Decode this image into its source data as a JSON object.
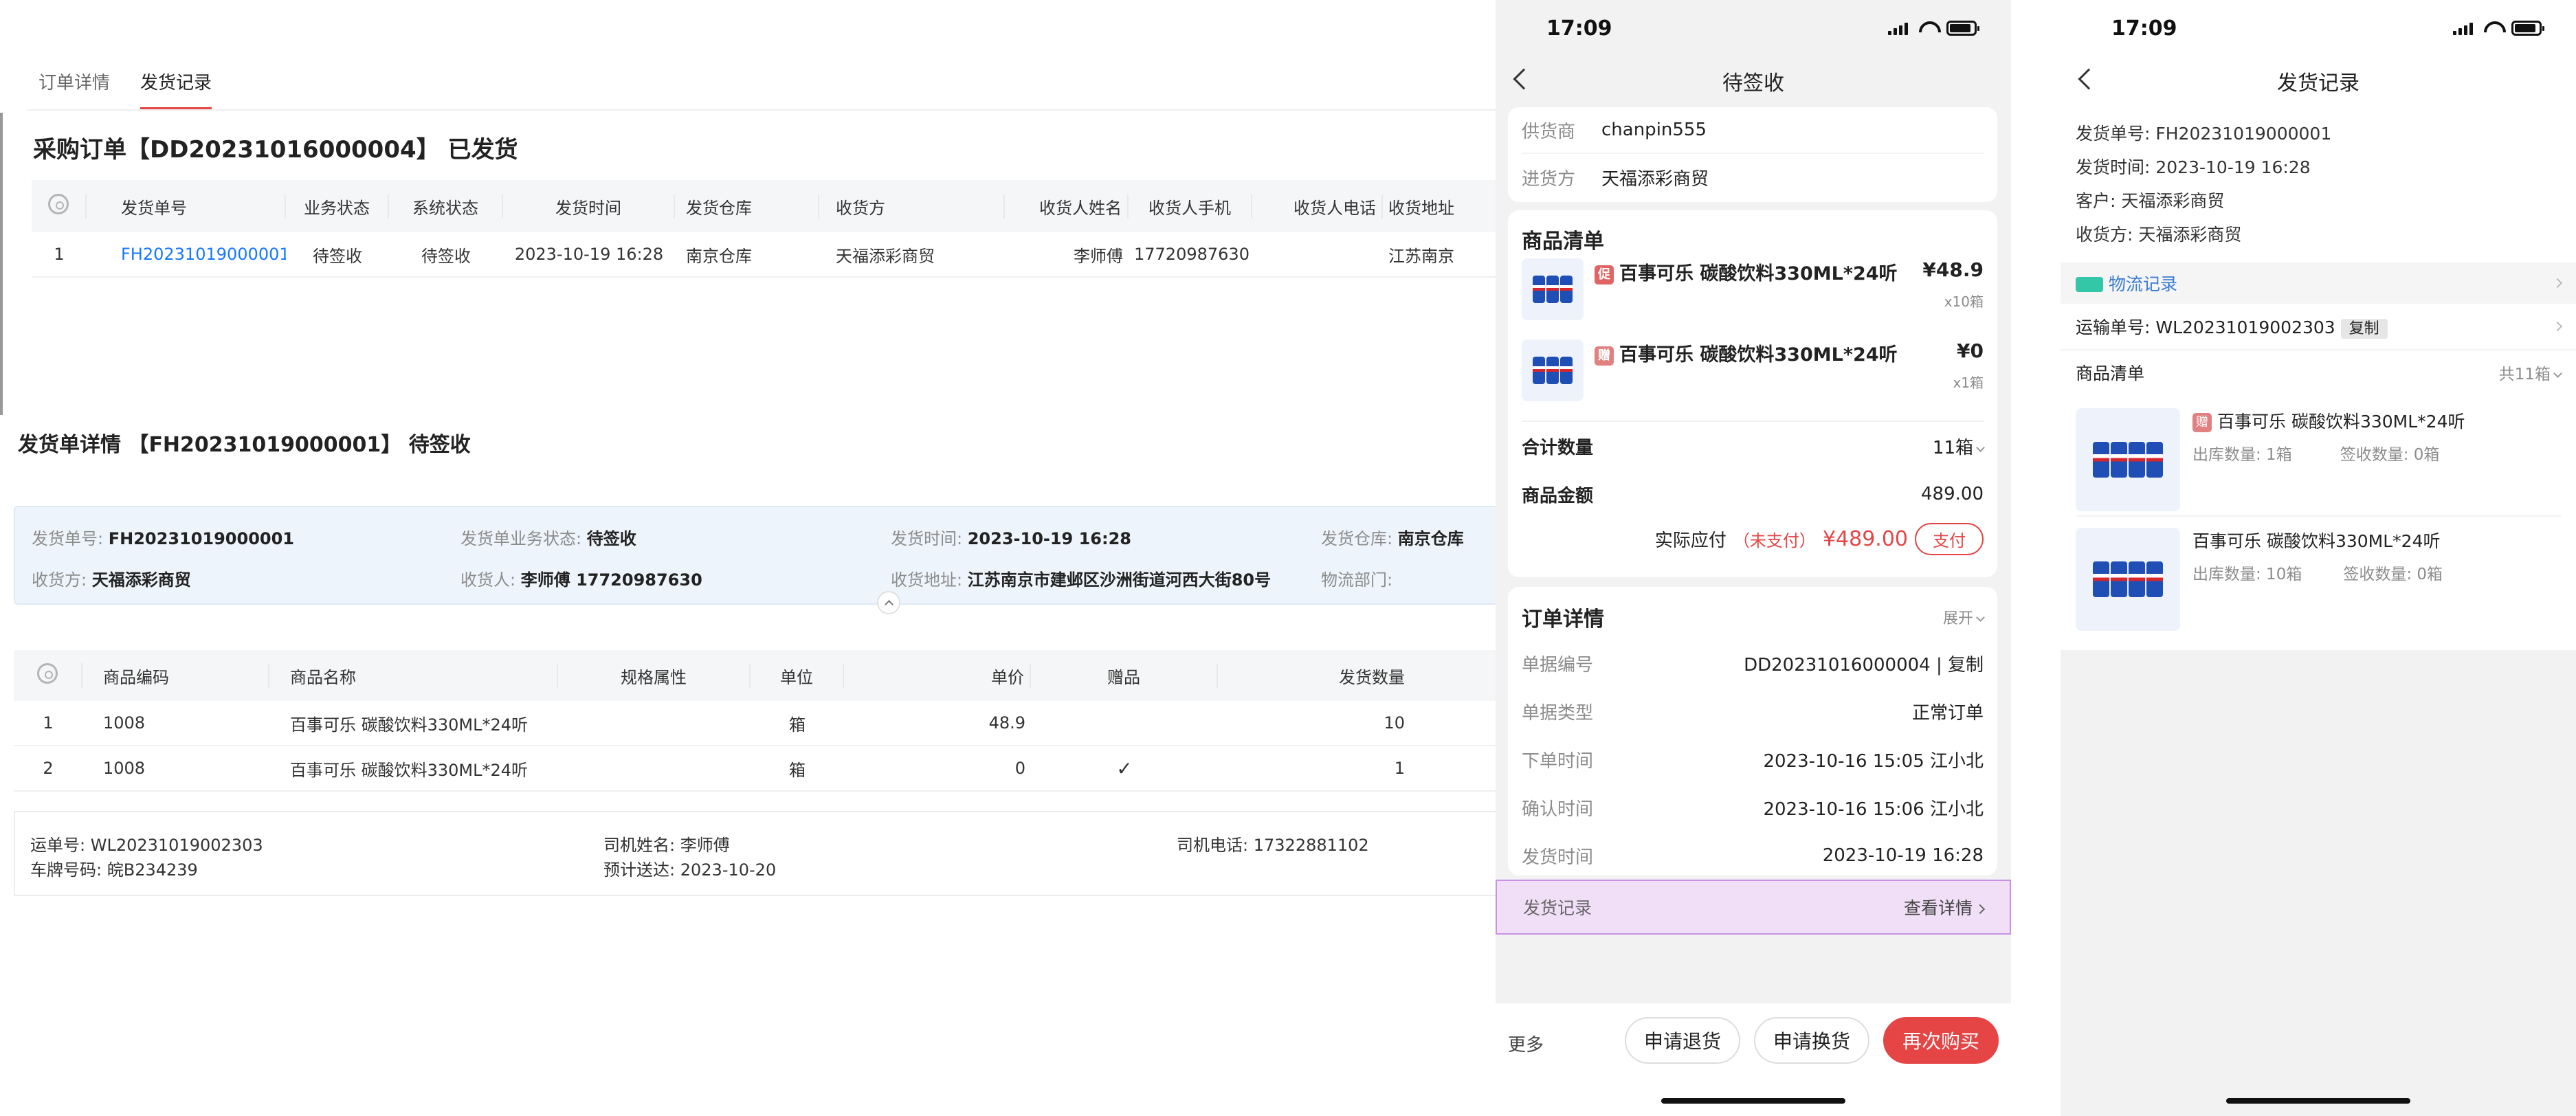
{
  "desktop": {
    "tabs": [
      {
        "label": "订单详情"
      },
      {
        "label": "发货记录"
      }
    ],
    "order_title": "采购订单【DD20231016000004】 已发货",
    "table1": {
      "headers": [
        "发货单号",
        "业务状态",
        "系统状态",
        "发货时间",
        "发货仓库",
        "收货方",
        "收货人姓名",
        "收货人手机",
        "收货人电话",
        "收货地址"
      ],
      "rows": [
        [
          "1",
          "FH20231019000001",
          "待签收",
          "待签收",
          "2023-10-19 16:28",
          "南京仓库",
          "天福添彩商贸",
          "李师傅",
          "17720987630",
          "",
          "江苏南京"
        ]
      ]
    },
    "detail_title": "发货单详情 【FH20231019000001】 待签收",
    "info": {
      "ship_no_label": "发货单号:",
      "ship_no": "FH20231019000001",
      "biz_status_label": "发货单业务状态:",
      "biz_status": "待签收",
      "ship_time_label": "发货时间:",
      "ship_time": "2023-10-19 16:28",
      "warehouse_label": "发货仓库:",
      "warehouse": "南京仓库",
      "receiver_label": "收货方:",
      "receiver": "天福添彩商贸",
      "contact_label": "收货人:",
      "contact": "李师傅 17720987630",
      "address_label": "收货地址:",
      "address": "江苏南京市建邺区沙洲街道河西大街80号",
      "logistics_label": "物流部门:",
      "logistics": ""
    },
    "table2": {
      "headers": [
        "商品编码",
        "商品名称",
        "规格属性",
        "单位",
        "单价",
        "赠品",
        "发货数量"
      ],
      "rows": [
        [
          "1",
          "1008",
          "百事可乐 碳酸饮料330ML*24听",
          "",
          "箱",
          "48.9",
          "",
          "10"
        ],
        [
          "2",
          "1008",
          "百事可乐 碳酸饮料330ML*24听",
          "",
          "箱",
          "0",
          "✓",
          "1"
        ]
      ]
    },
    "shipping": {
      "waybill_label": "运单号:",
      "waybill": "WL20231019002303",
      "driver_label": "司机姓名:",
      "driver": "李师傅",
      "driver_phone_label": "司机电话:",
      "driver_phone": "17322881102",
      "plate_label": "车牌号码:",
      "plate": "皖B234239",
      "eta_label": "预计送达:",
      "eta": "2023-10-20"
    }
  },
  "phone1": {
    "time": "17:09",
    "title": "待签收",
    "supplier_label": "供货商",
    "supplier": "chanpin555",
    "buyer_label": "进货方",
    "buyer": "天福添彩商贸",
    "goods_title": "商品清单",
    "items": [
      {
        "badge": "促",
        "name": "百事可乐 碳酸饮料330ML*24听",
        "price": "¥48.9",
        "qty": "x10箱"
      },
      {
        "badge": "赠",
        "name": "百事可乐 碳酸饮料330ML*24听",
        "price": "¥0",
        "qty": "x1箱"
      }
    ],
    "total_qty_label": "合计数量",
    "total_qty": "11箱",
    "amount_label": "商品金额",
    "amount": "489.00",
    "payable_label": "实际应付",
    "unpaid": "（未支付）",
    "payable": "¥489.00",
    "pay_button": "支付",
    "order_detail_title": "订单详情",
    "expand_label": "展开",
    "details": [
      {
        "label": "单据编号",
        "value": "DD20231016000004 | 复制"
      },
      {
        "label": "单据类型",
        "value": "正常订单"
      },
      {
        "label": "下单时间",
        "value": "2023-10-16 15:05 江小北"
      },
      {
        "label": "确认时间",
        "value": "2023-10-16 15:06 江小北"
      },
      {
        "label": "发货时间",
        "value": "2023-10-19 16:28"
      }
    ],
    "ship_record_label": "发货记录",
    "view_detail": "查看详情",
    "more_label": "更多",
    "btn_return": "申请退货",
    "btn_exchange": "申请换货",
    "btn_rebuy": "再次购买",
    "accent": "#e54545"
  },
  "phone2": {
    "time": "17:09",
    "title": "发货记录",
    "ship_no": "发货单号: FH20231019000001",
    "ship_time": "发货时间: 2023-10-19 16:28",
    "customer": "客户: 天福添彩商贸",
    "receiver": "收货方: 天福添彩商贸",
    "logistics_label": "物流记录",
    "waybill": "运输单号: WL20231019002303",
    "copy_label": "复制",
    "goods_title": "商品清单",
    "goods_total": "共11箱",
    "items": [
      {
        "badge": "赠",
        "name": "百事可乐 碳酸饮料330ML*24听",
        "out_qty": "出库数量: 1箱",
        "sign_qty": "签收数量: 0箱"
      },
      {
        "badge": "",
        "name": "百事可乐 碳酸饮料330ML*24听",
        "out_qty": "出库数量: 10箱",
        "sign_qty": "签收数量: 0箱"
      }
    ]
  }
}
